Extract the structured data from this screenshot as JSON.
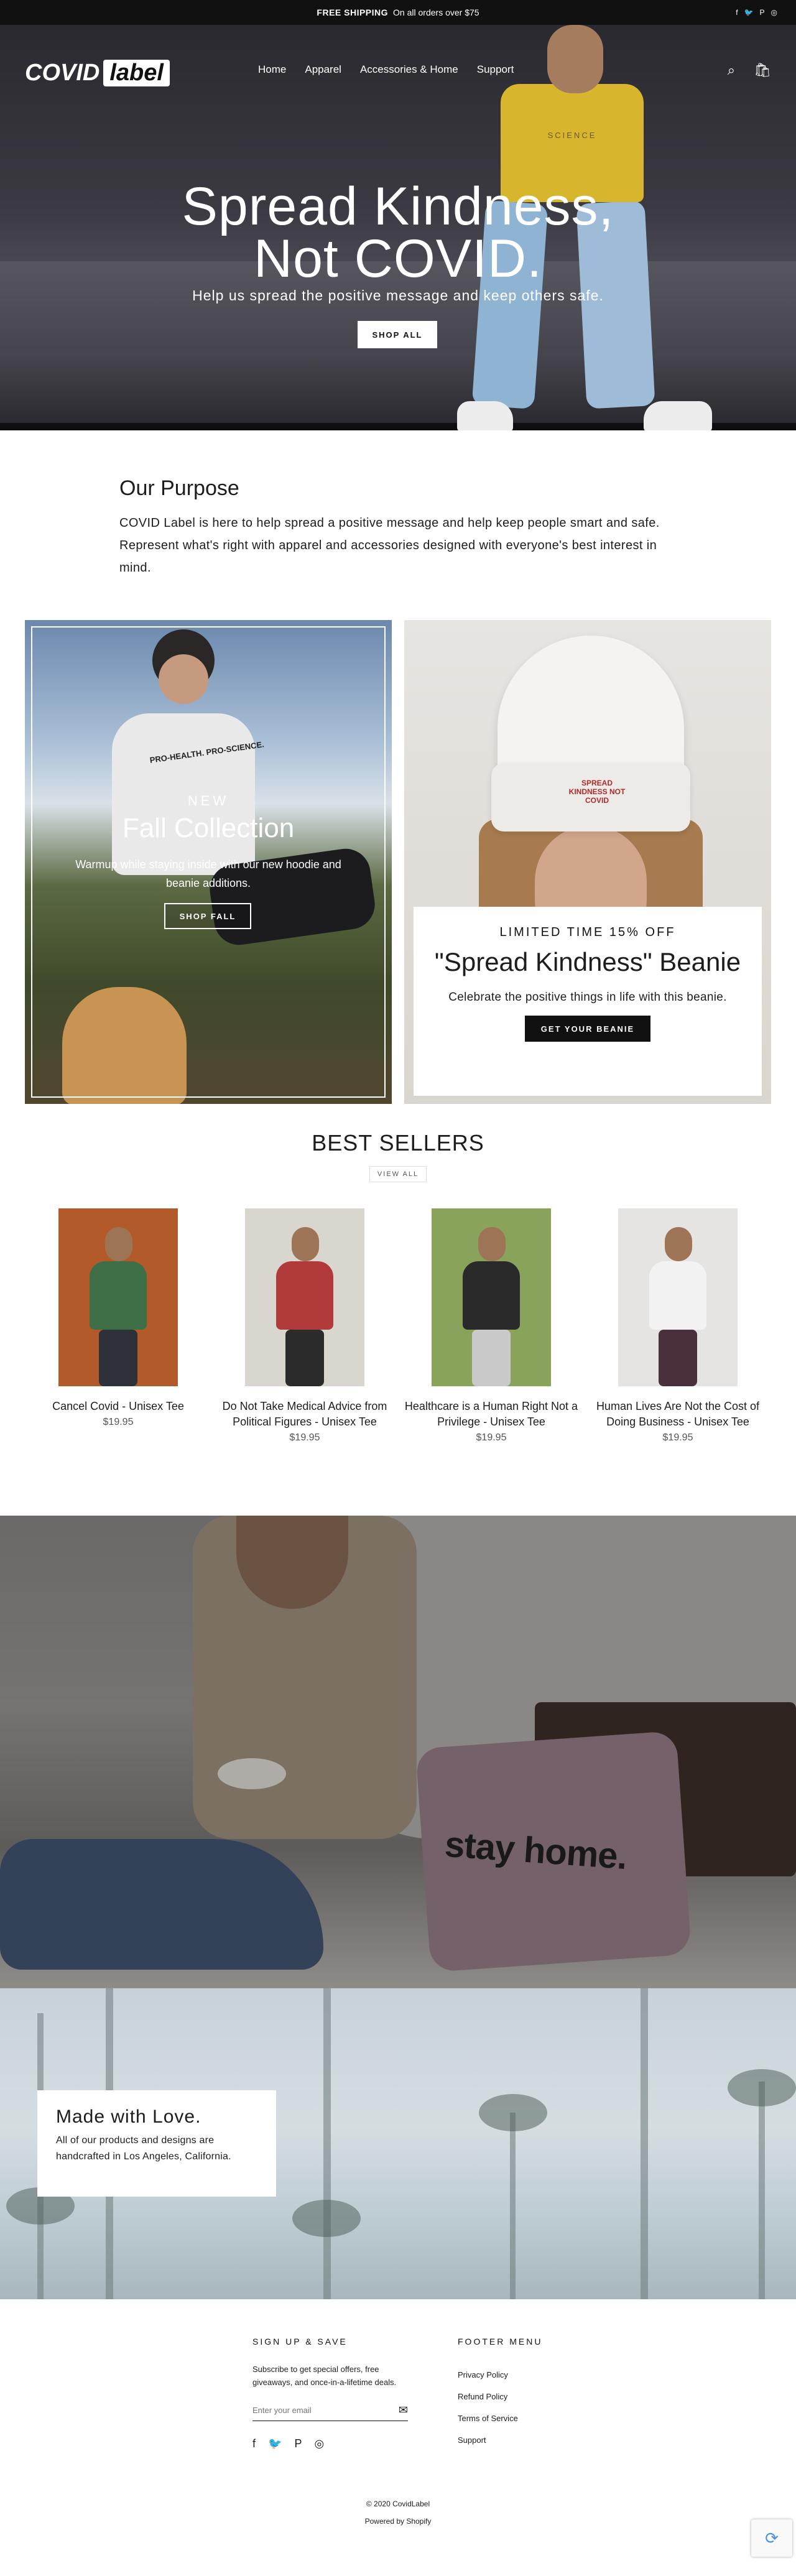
{
  "announcement": {
    "bold": "FREE SHIPPING",
    "text": "On all orders over $75"
  },
  "header": {
    "logo_text": "COVID",
    "logo_box": "label",
    "nav": [
      "Home",
      "Apparel",
      "Accessories & Home",
      "Support"
    ]
  },
  "hero": {
    "title_line1": "Spread Kindness,",
    "title_line2": "Not COVID.",
    "subtitle": "Help us spread the positive message and keep others safe.",
    "button": "SHOP ALL",
    "shirt_text": "SCIENCE"
  },
  "purpose": {
    "title": "Our Purpose",
    "text": "COVID Label is here to help spread a positive message and help keep people smart and safe. Represent what's right with apparel and accessories designed with everyone's best interest in mind."
  },
  "promo_left": {
    "eyebrow": "NEW",
    "title": "Fall Collection",
    "desc": "Warmup while staying inside with our new hoodie and beanie additions.",
    "button": "SHOP FALL",
    "hoodie_text": "PRO-HEALTH. PRO-SCIENCE."
  },
  "promo_right": {
    "eyebrow": "LIMITED TIME 15% OFF",
    "title": "\"Spread Kindness\" Beanie",
    "desc": "Celebrate the positive things in life with this beanie.",
    "button": "GET YOUR BEANIE",
    "beanie_text": "SPREAD KINDNESS NOT COVID"
  },
  "bestsellers": {
    "title": "BEST SELLERS",
    "view_all": "VIEW ALL",
    "products": [
      {
        "name": "Cancel Covid - Unisex Tee",
        "price": "$19.95",
        "tee": "#3f6f47",
        "legs": "#2f3138",
        "bg": "#b35a2a"
      },
      {
        "name": "Do Not Take Medical Advice from Political Figures - Unisex Tee",
        "price": "$19.95",
        "tee": "#b13b3b",
        "legs": "#2b2b2b",
        "bg": "#d9d6cf"
      },
      {
        "name": "Healthcare is a Human Right Not a Privilege - Unisex Tee",
        "price": "$19.95",
        "tee": "#2a2a2a",
        "legs": "#c9c9c9",
        "bg": "#8aa35a"
      },
      {
        "name": "Human Lives Are Not the Cost of Doing Business - Unisex Tee",
        "price": "$19.95",
        "tee": "#f2f2f2",
        "legs": "#4a2f3c",
        "bg": "#e6e4e2"
      }
    ]
  },
  "stayhome": {
    "pillow_text": "stay home."
  },
  "madewithlove": {
    "title": "Made with Love.",
    "text": "All of our products and designs are handcrafted in Los Angeles, California."
  },
  "footer": {
    "signup_label": "SIGN UP & SAVE",
    "signup_text": "Subscribe to get special offers, free giveaways, and once-in-a-lifetime deals.",
    "email_placeholder": "Enter your email",
    "menu_label": "FOOTER MENU",
    "menu": [
      "Privacy Policy",
      "Refund Policy",
      "Terms of Service",
      "Support"
    ],
    "copyright": "© 2020 CovidLabel",
    "powered": "Powered by Shopify"
  }
}
